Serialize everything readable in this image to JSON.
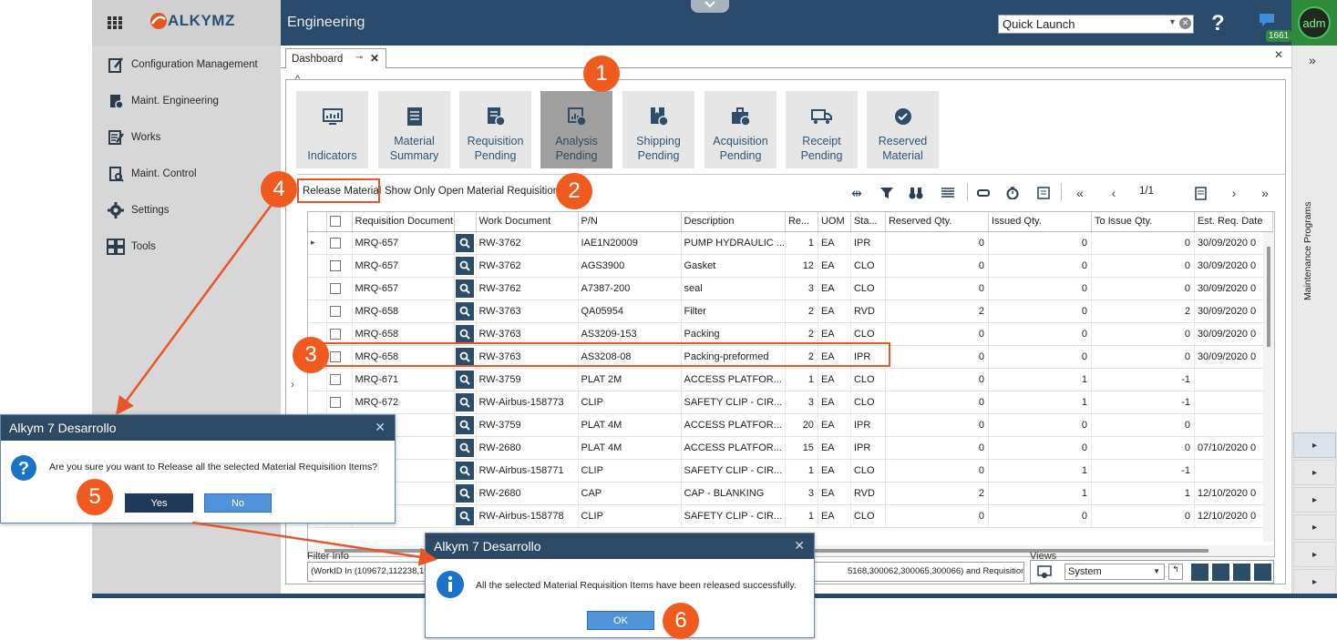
{
  "app": {
    "brand": "ALKYMZ",
    "module_title": "Engineering",
    "quick_launch_placeholder": "Quick Launch",
    "notifications_count": "1661",
    "user_initials": "adm"
  },
  "sidebar": {
    "items": [
      {
        "label": "Configuration Management",
        "icon": "clipboard-pencil-icon"
      },
      {
        "label": "Maint. Engineering",
        "icon": "clipboard-gear-icon"
      },
      {
        "label": "Works",
        "icon": "checklist-pencil-icon"
      },
      {
        "label": "Maint. Control",
        "icon": "clipboard-search-icon"
      },
      {
        "label": "Settings",
        "icon": "gear-icon"
      },
      {
        "label": "Tools",
        "icon": "tiles-icon"
      }
    ]
  },
  "right_panel": {
    "label": "Maintenance Programs",
    "expand": "»"
  },
  "tabs": {
    "dashboard": "Dashboard"
  },
  "tiles": [
    {
      "label": "Indicators",
      "icon": "monitor-chart-icon"
    },
    {
      "label": "Material Summary",
      "icon": "document-list-icon"
    },
    {
      "label": "Requisition Pending",
      "icon": "document-clock-icon"
    },
    {
      "label": "Analysis Pending",
      "icon": "chart-clock-icon"
    },
    {
      "label": "Shipping Pending",
      "icon": "bookmark-clock-icon"
    },
    {
      "label": "Acquisition Pending",
      "icon": "briefcase-clock-icon"
    },
    {
      "label": "Receipt Pending",
      "icon": "truck-clock-icon"
    },
    {
      "label": "Reserved Material",
      "icon": "check-circle-icon"
    }
  ],
  "toolbar": {
    "release": "Release Material",
    "show_only_open": "Show Only Open Material Requisitions",
    "page": "1/1"
  },
  "grid": {
    "columns": [
      "",
      "Requisition Document",
      "",
      "Work Document",
      "P/N",
      "Description",
      "Re...",
      "UOM",
      "Sta...",
      "Reserved Qty.",
      "Issued Qty.",
      "To Issue Qty.",
      "Est. Req. Date"
    ],
    "rows": [
      [
        "MRQ-657",
        "RW-3762",
        "IAE1N20009",
        "PUMP HYDRAULIC ...",
        "1",
        "EA",
        "IPR",
        "0",
        "0",
        "0",
        "30/09/2020 0"
      ],
      [
        "MRQ-657",
        "RW-3762",
        "AGS3900",
        "Gasket",
        "12",
        "EA",
        "CLO",
        "0",
        "0",
        "0",
        "30/09/2020 0"
      ],
      [
        "MRQ-657",
        "RW-3762",
        "A7387-200",
        "seal",
        "3",
        "EA",
        "CLO",
        "0",
        "0",
        "0",
        "30/09/2020 0"
      ],
      [
        "MRQ-658",
        "RW-3763",
        "QA05954",
        "Filter",
        "2",
        "EA",
        "RVD",
        "2",
        "0",
        "2",
        "30/09/2020 0"
      ],
      [
        "MRQ-658",
        "RW-3763",
        "AS3209-153",
        "Packing",
        "2",
        "EA",
        "CLO",
        "0",
        "0",
        "0",
        "30/09/2020 0"
      ],
      [
        "MRQ-658",
        "RW-3763",
        "AS3208-08",
        "Packing-preformed",
        "2",
        "EA",
        "IPR",
        "0",
        "0",
        "0",
        "30/09/2020 0"
      ],
      [
        "MRQ-671",
        "RW-3759",
        "PLAT 2M",
        "ACCESS PLATFOR...",
        "1",
        "EA",
        "CLO",
        "0",
        "1",
        "-1",
        ""
      ],
      [
        "MRQ-672",
        "RW-Airbus-158773",
        "CLIP",
        "SAFETY CLIP - CIR...",
        "3",
        "EA",
        "CLO",
        "0",
        "1",
        "-1",
        ""
      ],
      [
        "",
        "RW-3759",
        "PLAT 4M",
        "ACCESS PLATFOR...",
        "20",
        "EA",
        "IPR",
        "0",
        "0",
        "0",
        ""
      ],
      [
        "",
        "RW-2680",
        "PLAT 4M",
        "ACCESS PLATFOR...",
        "15",
        "EA",
        "IPR",
        "0",
        "0",
        "0",
        "07/10/2020 0"
      ],
      [
        "",
        "RW-Airbus-158771",
        "CLIP",
        "SAFETY CLIP - CIR...",
        "1",
        "EA",
        "CLO",
        "0",
        "1",
        "-1",
        ""
      ],
      [
        "",
        "RW-2680",
        "CAP",
        "CAP - BLANKING",
        "3",
        "EA",
        "RVD",
        "2",
        "1",
        "1",
        "12/10/2020 0"
      ],
      [
        "",
        "RW-Airbus-158778",
        "CLIP",
        "SAFETY CLIP - CIR...",
        "1",
        "EA",
        "CLO",
        "0",
        "0",
        "0",
        "12/10/2020 0"
      ]
    ]
  },
  "filter": {
    "label": "Filter Info",
    "text_left": "(WorkID In (109672,112238,19",
    "text_right": "5168,300062,300065,300066) and RequisitionType = 1)"
  },
  "views": {
    "label": "Views",
    "selected": "System"
  },
  "dialog_confirm": {
    "title": "Alkym 7 Desarrollo",
    "message": "Are you sure you want to Release all the selected Material Requisition Items?",
    "yes": "Yes",
    "no": "No"
  },
  "dialog_info": {
    "title": "Alkym 7 Desarrollo",
    "message": "All the selected Material Requisition Items have been released successfully.",
    "ok": "OK"
  },
  "annotations": {
    "b1": "1",
    "b2": "2",
    "b3": "3",
    "b4": "4",
    "b5": "5",
    "b6": "6"
  },
  "colors": {
    "accent": "#2a4a6b",
    "annotation": "#f05a1e",
    "tile_active": "#a0a0a0"
  }
}
